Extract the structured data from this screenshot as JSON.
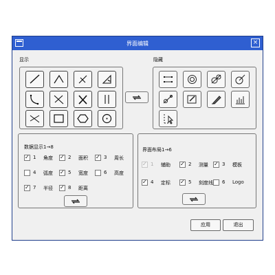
{
  "window": {
    "title": "界面编辑",
    "close": "×"
  },
  "sections": {
    "show": "显示",
    "hidden": "隐藏"
  },
  "tools": {
    "shown": [
      "segment",
      "angle",
      "line",
      "angle-measure",
      "arc",
      "parallel",
      "cross",
      "double-line",
      "curve",
      "rectangle",
      "hexagon",
      "circle-point"
    ],
    "hidden": [
      "horizontal-line",
      "concentric",
      "target",
      "radius",
      "compass",
      "note",
      "pen",
      "bar-chart",
      "grid-cursor"
    ]
  },
  "data_panel": {
    "title": "数据显示1→8",
    "items": [
      {
        "num": "1",
        "label": "角度",
        "checked": true
      },
      {
        "num": "2",
        "label": "面积",
        "checked": true
      },
      {
        "num": "3",
        "label": "周长",
        "checked": true
      },
      {
        "num": "4",
        "label": "弧度",
        "checked": false
      },
      {
        "num": "5",
        "label": "宽度",
        "checked": true
      },
      {
        "num": "6",
        "label": "高度",
        "checked": false
      },
      {
        "num": "7",
        "label": "半径",
        "checked": true
      },
      {
        "num": "8",
        "label": "距离",
        "checked": true
      }
    ]
  },
  "layout_panel": {
    "title": "界面布局1→6",
    "items": [
      {
        "num": "1",
        "label": "辅助",
        "checked": true,
        "disabled": true
      },
      {
        "num": "2",
        "label": "测量",
        "checked": true,
        "disabled": false
      },
      {
        "num": "3",
        "label": "模板",
        "checked": true,
        "disabled": false
      },
      {
        "num": "4",
        "label": "定标",
        "checked": true,
        "disabled": false
      },
      {
        "num": "5",
        "label": "刻度线",
        "checked": true,
        "disabled": false
      },
      {
        "num": "6",
        "label": "Logo",
        "checked": false,
        "disabled": false
      }
    ]
  },
  "buttons": {
    "apply": "应用",
    "exit": "退出"
  }
}
